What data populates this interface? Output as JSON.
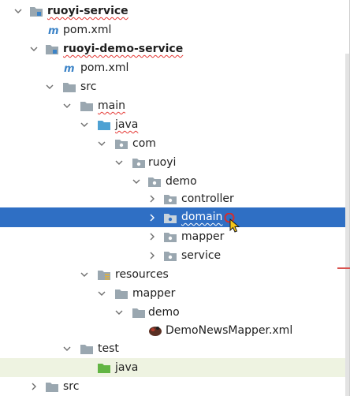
{
  "tree": {
    "nodes": [
      {
        "id": "n0",
        "label": "ruoyi-service",
        "icon": "module-folder-icon",
        "expanded": true,
        "bold": true,
        "squiggle": true
      },
      {
        "id": "n1",
        "label": "pom.xml",
        "icon": "maven-icon"
      },
      {
        "id": "n2",
        "label": "ruoyi-demo-service",
        "icon": "module-folder-icon",
        "expanded": true,
        "bold": true,
        "squiggle": true
      },
      {
        "id": "n3",
        "label": "pom.xml",
        "icon": "maven-icon"
      },
      {
        "id": "n4",
        "label": "src",
        "icon": "folder-icon",
        "expanded": true
      },
      {
        "id": "n5",
        "label": "main",
        "icon": "folder-icon",
        "expanded": true,
        "squiggle": true
      },
      {
        "id": "n6",
        "label": "java",
        "icon": "source-root-folder-icon",
        "expanded": true,
        "squiggle": true
      },
      {
        "id": "n7",
        "label": "com",
        "icon": "package-icon",
        "expanded": true
      },
      {
        "id": "n8",
        "label": "ruoyi",
        "icon": "package-icon",
        "expanded": true
      },
      {
        "id": "n9",
        "label": "demo",
        "icon": "package-icon",
        "expanded": true
      },
      {
        "id": "n10",
        "label": "controller",
        "icon": "package-icon",
        "expanded": false
      },
      {
        "id": "n11",
        "label": "domain",
        "icon": "package-icon",
        "expanded": false,
        "selected": true,
        "squiggle": true
      },
      {
        "id": "n12",
        "label": "mapper",
        "icon": "package-icon",
        "expanded": false
      },
      {
        "id": "n13",
        "label": "service",
        "icon": "package-icon",
        "expanded": false
      },
      {
        "id": "n14",
        "label": "resources",
        "icon": "resources-folder-icon",
        "expanded": true
      },
      {
        "id": "n15",
        "label": "mapper",
        "icon": "folder-icon",
        "expanded": true
      },
      {
        "id": "n16",
        "label": "demo",
        "icon": "folder-icon",
        "expanded": true
      },
      {
        "id": "n17",
        "label": "DemoNewsMapper.xml",
        "icon": "mybatis-xml-icon"
      },
      {
        "id": "n18",
        "label": "test",
        "icon": "folder-icon",
        "expanded": true
      },
      {
        "id": "n19",
        "label": "java",
        "icon": "test-source-folder-icon",
        "tinted": true
      },
      {
        "id": "n20",
        "label": "src",
        "icon": "folder-icon",
        "expanded": false
      }
    ]
  },
  "colors": {
    "selection": "#2f6fc4",
    "squiggle": "#e53935",
    "folder": "#9aa7b0",
    "source_root": "#4ea1d3",
    "test_root": "#62b543",
    "maven": "#3b83c7"
  }
}
